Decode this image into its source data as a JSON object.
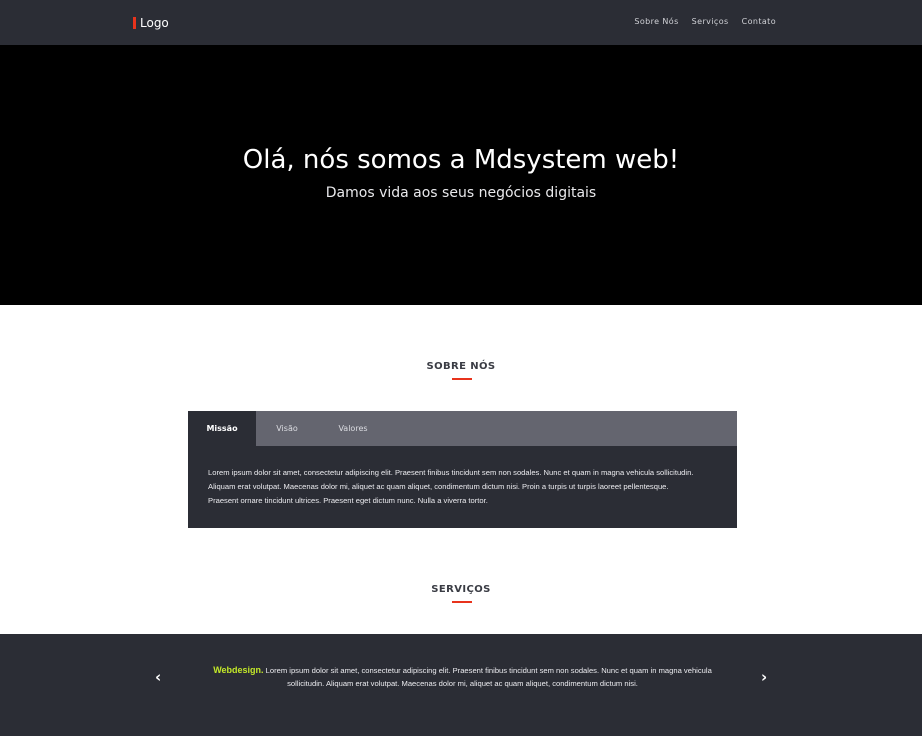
{
  "header": {
    "logo_text": "Logo",
    "nav": [
      "Sobre Nós",
      "Serviços",
      "Contato"
    ]
  },
  "hero": {
    "title": "Olá, nós somos a Mdsystem web!",
    "subtitle": "Damos vida aos seus negócios digitais"
  },
  "about": {
    "title": "SOBRE NÓS",
    "tabs": [
      "Missão",
      "Visão",
      "Valores"
    ],
    "active_tab": "Missão",
    "content": "Lorem ipsum dolor sit amet, consectetur adipiscing elit. Praesent finibus tincidunt sem non sodales. Nunc et quam in magna vehicula sollicitudin. Aliquam erat volutpat. Maecenas dolor mi, aliquet ac quam aliquet, condimentum dictum nisi. Proin a turpis ut turpis laoreet pellentesque. Praesent ornare tincidunt ultrices. Praesent eget dictum nunc. Nulla a viverra tortor."
  },
  "services": {
    "title": "SERVIÇOS",
    "slide_title": "Webdesign.",
    "slide_text": " Lorem ipsum dolor sit amet, consectetur adipiscing elit. Praesent finibus tincidunt sem non sodales. Nunc et quam in magna vehicula sollicitudin. Aliquam erat volutpat. Maecenas dolor mi, aliquet ac quam aliquet, condimentum dictum nisi.",
    "prev_arrow": "‹",
    "next_arrow": "›"
  },
  "colors": {
    "header_bg": "#2b2d35",
    "accent": "#e8331c",
    "highlight": "#c3e829",
    "tab_bar": "#64656f"
  }
}
